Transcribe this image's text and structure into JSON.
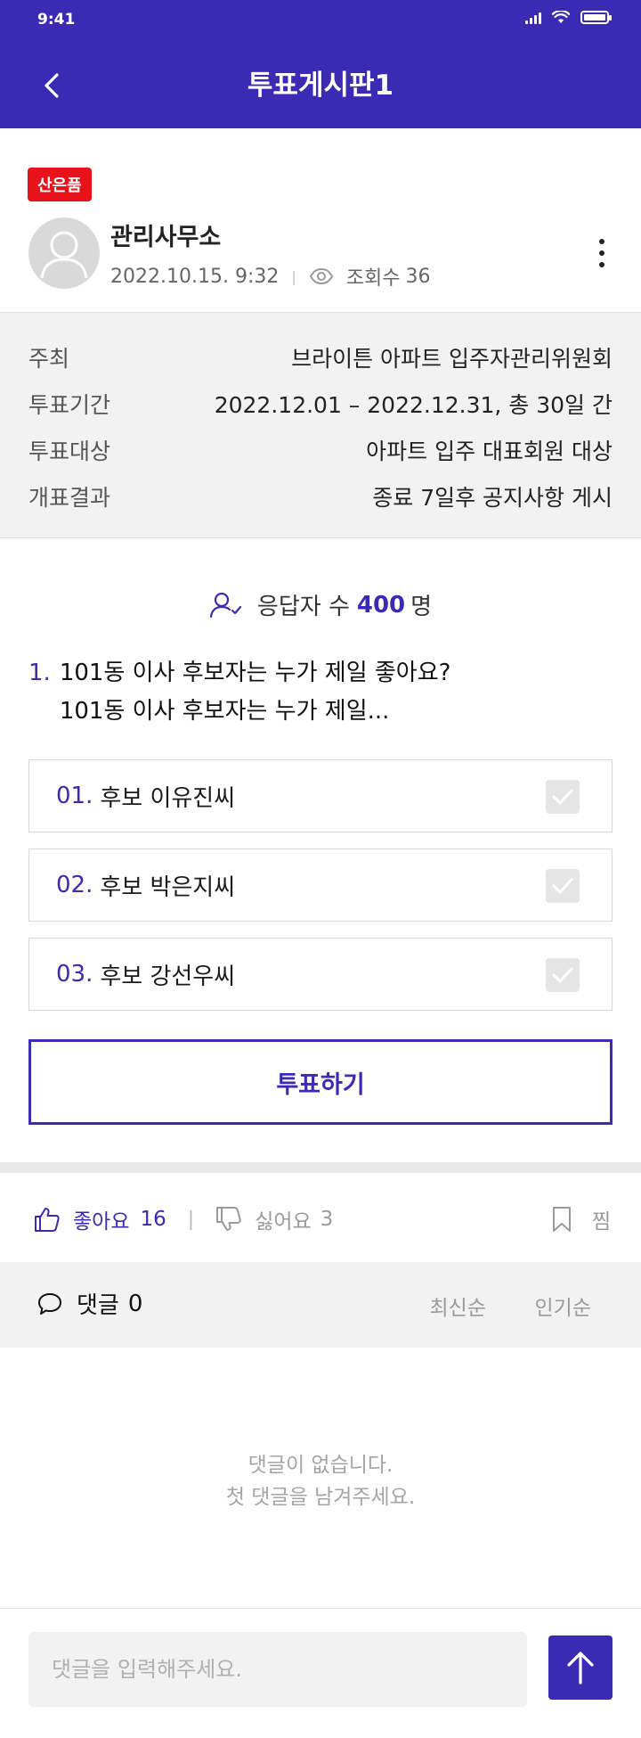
{
  "status_bar": {
    "time": "9:41"
  },
  "header": {
    "title": "투표게시판1"
  },
  "post": {
    "badge": "산은품",
    "author": "관리사무소",
    "datetime": "2022.10.15. 9:32",
    "views_label": "조회수",
    "views": "36"
  },
  "info": [
    {
      "key": "주최",
      "value": "브라이튼 아파트 입주자관리위원회"
    },
    {
      "key": "투표기간",
      "value": "2022.12.01 – 2022.12.31, 총 30일 간"
    },
    {
      "key": "투표대상",
      "value": "아파트 입주 대표회원 대상"
    },
    {
      "key": "개표결과",
      "value": "종료 7일후 공지사항 게시"
    }
  ],
  "vote": {
    "responders_label": "응답자 수",
    "responders_count": "400",
    "responders_unit": "명",
    "question_number": "1.",
    "question_line1": "101동 이사 후보자는 누가 제일 좋아요?",
    "question_line2": "101동 이사 후보자는 누가 제일...",
    "options": [
      {
        "num": "01.",
        "label": "후보 이유진씨",
        "checked": false
      },
      {
        "num": "02.",
        "label": "후보 박은지씨",
        "checked": false
      },
      {
        "num": "03.",
        "label": "후보 강선우씨",
        "checked": false
      }
    ],
    "submit_label": "투표하기"
  },
  "reactions": {
    "like_label": "좋아요",
    "like_count": "16",
    "dislike_label": "싫어요",
    "dislike_count": "3",
    "bookmark_label": "찜"
  },
  "comments": {
    "title": "댓글",
    "count": "0",
    "sort_latest": "최신순",
    "sort_popular": "인기순",
    "empty_line1": "댓글이 없습니다.",
    "empty_line2": "첫 댓글을 남겨주세요.",
    "input_placeholder": "댓글을 입력해주세요."
  },
  "colors": {
    "primary": "#3b2bb4",
    "badge": "#e8121b",
    "muted": "#9a9a9a"
  }
}
